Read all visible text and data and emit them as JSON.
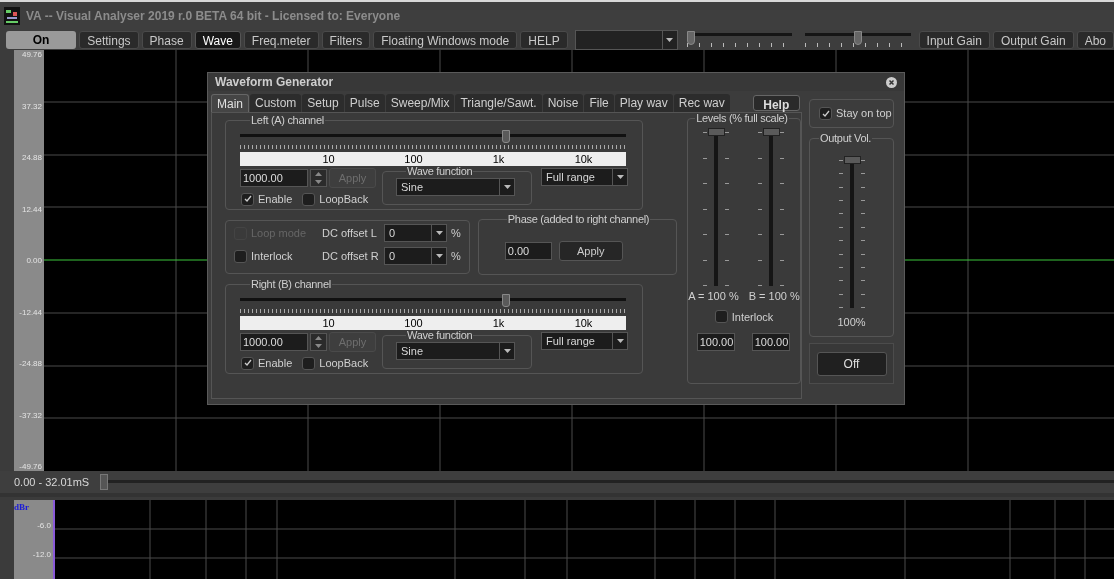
{
  "window": {
    "title": "VA -- Visual Analyser 2019 r.0 BETA 64 bit - Licensed to: Everyone"
  },
  "toolbar": {
    "buttons": [
      {
        "label": "On",
        "kind": "power",
        "selected": true
      },
      {
        "label": "Settings",
        "kind": "tab",
        "selected": false
      },
      {
        "label": "Phase",
        "kind": "tab",
        "selected": false
      },
      {
        "label": "Wave",
        "kind": "tab",
        "selected": true
      },
      {
        "label": "Freq.meter",
        "kind": "tab",
        "selected": false
      },
      {
        "label": "Filters",
        "kind": "tab",
        "selected": false
      },
      {
        "label": "Floating Windows mode",
        "kind": "tab",
        "selected": false
      },
      {
        "label": "HELP",
        "kind": "tab",
        "selected": false
      }
    ],
    "sliders": [
      {
        "level": 0.0
      },
      {
        "level": 0.5
      }
    ],
    "gain_buttons": [
      "Input Gain",
      "Output Gain",
      "Abo"
    ]
  },
  "scope": {
    "y_labels": [
      "49.76",
      "37.32",
      "24.88",
      "12.44",
      "0.00",
      "-12.44",
      "-24.88",
      "-37.32",
      "-49.76"
    ],
    "time_range": "0.00 - 32.01mS",
    "time_slider": {
      "level": 0.0
    }
  },
  "spectrum": {
    "unit": "dBr",
    "y_labels": [
      "-6.0",
      "-12.0"
    ]
  },
  "generator": {
    "title": "Waveform Generator",
    "tabs": [
      {
        "label": "Main",
        "selected": true
      },
      {
        "label": "Custom",
        "selected": false
      },
      {
        "label": "Setup",
        "selected": false
      },
      {
        "label": "Pulse",
        "selected": false
      },
      {
        "label": "Sweep/Mix",
        "selected": false
      },
      {
        "label": "Triangle/Sawt.",
        "selected": false
      },
      {
        "label": "Noise",
        "selected": false
      },
      {
        "label": "File",
        "selected": false
      },
      {
        "label": "Play wav",
        "selected": false
      },
      {
        "label": "Rec wav",
        "selected": false
      }
    ],
    "help": "Help",
    "stay_on_top": {
      "label": "Stay on top",
      "checked": true
    },
    "channels": [
      {
        "title": "Left (A) channel",
        "level": 0.69,
        "scale": [
          "10",
          "100",
          "1k",
          "10k"
        ],
        "frequency": "1000.00",
        "apply": {
          "label": "Apply",
          "disabled": true
        },
        "enable": {
          "label": "Enable",
          "checked": true
        },
        "loopback": {
          "label": "LoopBack",
          "checked": false
        },
        "wave_function": {
          "title": "Wave function",
          "value": "Sine"
        },
        "range": "Full range"
      },
      {
        "title": "Right (B) channel",
        "level": 0.69,
        "scale": [
          "10",
          "100",
          "1k",
          "10k"
        ],
        "frequency": "1000.00",
        "apply": {
          "label": "Apply",
          "disabled": true
        },
        "enable": {
          "label": "Enable",
          "checked": true
        },
        "loopback": {
          "label": "LoopBack",
          "checked": false
        },
        "wave_function": {
          "title": "Wave function",
          "value": "Sine"
        },
        "range": "Full range"
      }
    ],
    "options": {
      "loop_mode": {
        "label": "Loop mode",
        "checked": false,
        "disabled": true
      },
      "interlock": {
        "label": "Interlock",
        "checked": false,
        "disabled": false
      },
      "dc_offsets": [
        {
          "label": "DC offset L",
          "value": "0",
          "unit": "%"
        },
        {
          "label": "DC offset R",
          "value": "0",
          "unit": "%"
        }
      ]
    },
    "phase": {
      "title": "Phase (added to right channel)",
      "value": "0.00",
      "apply": "Apply"
    },
    "levels": {
      "title": "Levels (% full scale)",
      "sliders": [
        {
          "level": 1.0,
          "reading": "A = 100 %",
          "value": "100.00"
        },
        {
          "level": 1.0,
          "reading": "B = 100 %",
          "value": "100.00"
        }
      ],
      "interlock": {
        "label": "Interlock",
        "checked": false
      }
    },
    "output_volume": {
      "title": "Output Vol.",
      "level": 1.0,
      "reading": "100%"
    },
    "power_button": "Off"
  }
}
